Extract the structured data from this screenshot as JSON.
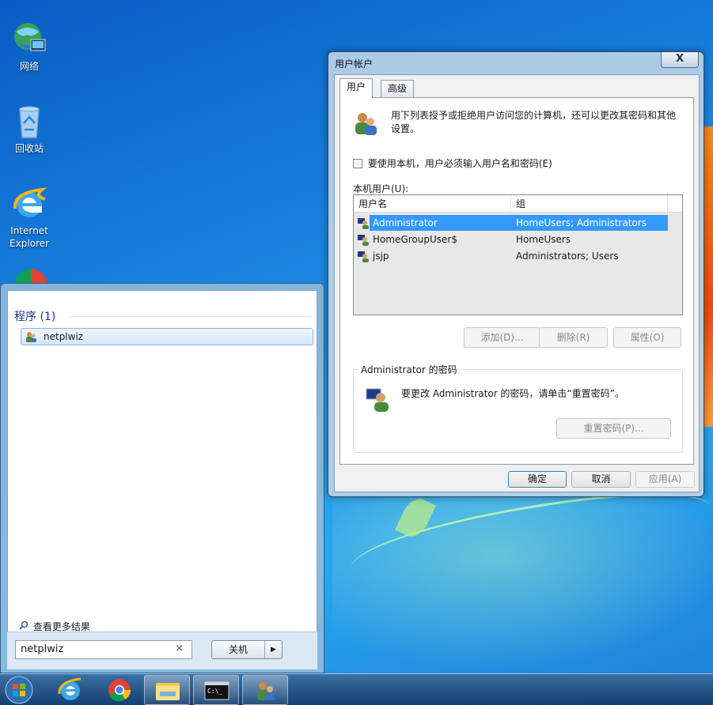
{
  "desktop": {
    "icons": [
      {
        "name": "network-icon",
        "label": "网络"
      },
      {
        "name": "recycle-bin-icon",
        "label": "回收站"
      },
      {
        "name": "internet-explorer-icon",
        "label": "Internet Explorer"
      }
    ]
  },
  "start_menu": {
    "section_title": "程序 (1)",
    "result_item": "netplwiz",
    "more_results": "查看更多结果",
    "search_value": "netplwiz",
    "clear_glyph": "×",
    "shutdown_label": "关机",
    "shutdown_arrow": "▶"
  },
  "dialog": {
    "title": "用户帐户",
    "close_glyph": "X",
    "tabs": [
      "用户",
      "高级"
    ],
    "info_text": "用下列表授予或拒绝用户访问您的计算机，还可以更改其密码和其他设置。",
    "checkbox_label": "要使用本机，用户必须输入用户名和密码(E)",
    "checkbox_checked": false,
    "users_label": "本机用户(U):",
    "columns": [
      "用户名",
      "组"
    ],
    "rows": [
      {
        "user": "Administrator",
        "group": "HomeUsers; Administrators",
        "selected": true
      },
      {
        "user": "HomeGroupUser$",
        "group": "HomeUsers",
        "selected": false
      },
      {
        "user": "jsjp",
        "group": "Administrators; Users",
        "selected": false
      }
    ],
    "buttons": {
      "add": "添加(D)...",
      "delete": "删除(R)",
      "properties": "属性(O)"
    },
    "password_group": {
      "title": "Administrator 的密码",
      "text": "要更改 Administrator 的密码，请单击“重置密码”。",
      "reset_button": "重置密码(P)..."
    },
    "footer": {
      "ok": "确定",
      "cancel": "取消",
      "apply": "应用(A)"
    }
  },
  "colors": {
    "selection": "#3399ff",
    "link_blue": "#1e3287"
  }
}
